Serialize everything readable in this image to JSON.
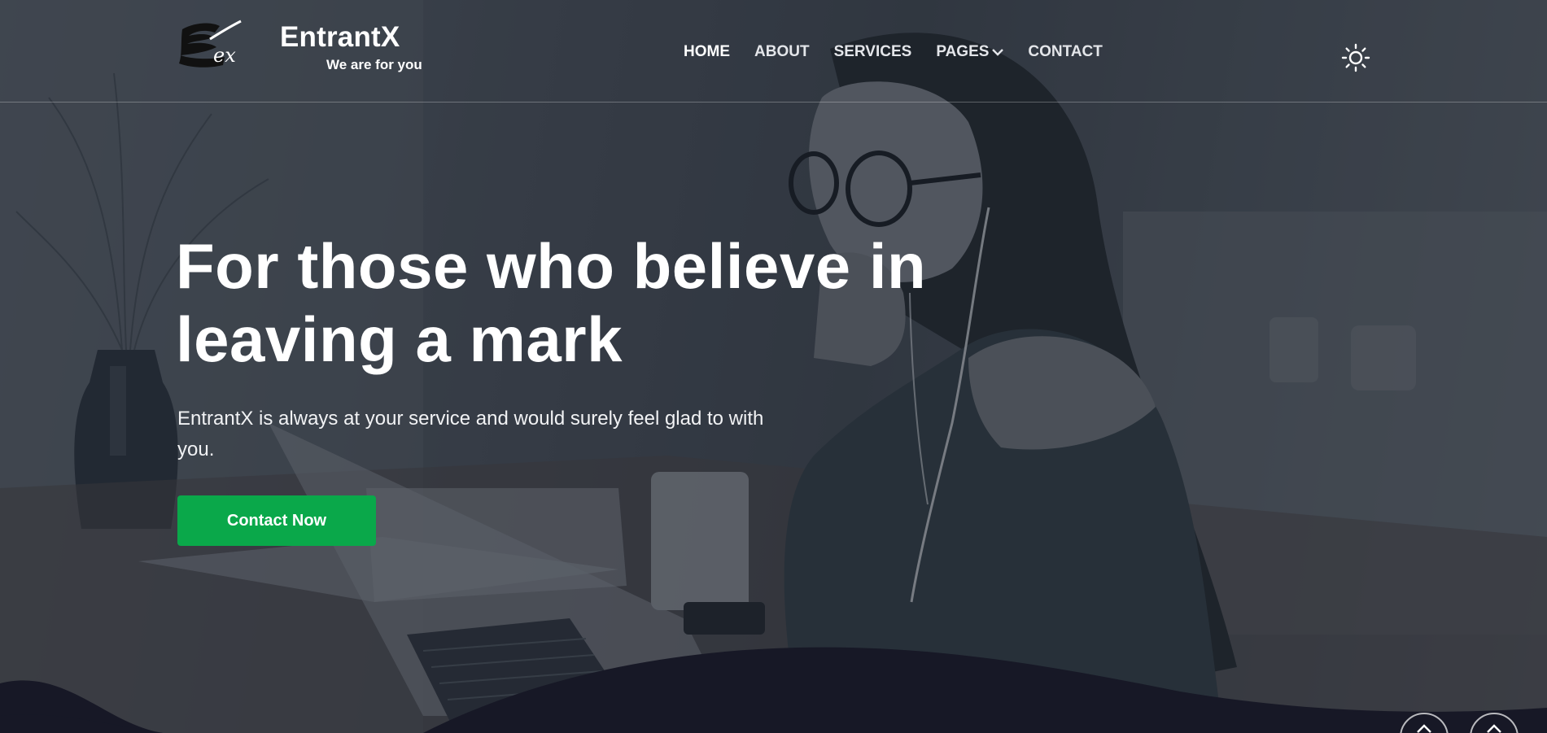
{
  "brand": {
    "name": "EntrantX",
    "tagline": "We are for you",
    "logo_letters": "ex"
  },
  "nav": {
    "items": [
      {
        "label": "HOME",
        "active": true
      },
      {
        "label": "ABOUT",
        "active": false
      },
      {
        "label": "SERVICES",
        "active": false
      },
      {
        "label": "PAGES",
        "active": false,
        "has_dropdown": true
      },
      {
        "label": "CONTACT",
        "active": false
      }
    ],
    "theme_toggle_icon": "sun-icon"
  },
  "hero": {
    "title": "For those who believe in leaving a mark",
    "description": "EntrantX is always at your service and would surely feel glad to with you.",
    "cta_label": "Contact Now"
  },
  "colors": {
    "accent": "#0aa84a",
    "dark_section": "#171826",
    "text": "#ffffff"
  },
  "floating_buttons": [
    {
      "icon": "chevron-up-icon"
    },
    {
      "icon": "chevron-up-icon"
    }
  ]
}
